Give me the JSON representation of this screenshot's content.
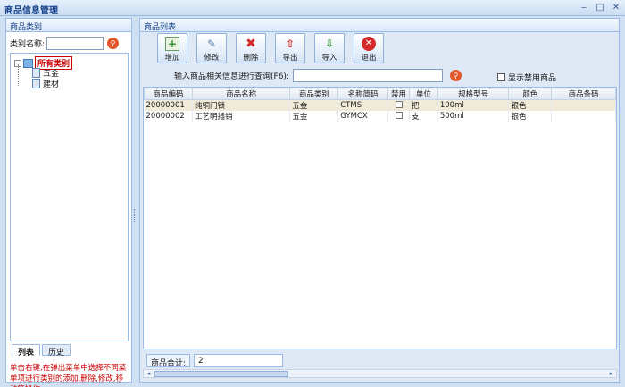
{
  "window": {
    "title": "商品信息管理",
    "minimize": "‒",
    "maximize": "□",
    "close": "✕"
  },
  "left": {
    "header": "商品类别",
    "search_label": "类别名称:",
    "search_value": "",
    "search_icon": "search-icon",
    "tree": {
      "root": "所有类别",
      "children": [
        "五金",
        "建材"
      ]
    },
    "tabs": [
      "列表",
      "历史"
    ],
    "hint": "单击右键,在弹出菜单中选择不同菜单项进行类别的添加,删除,修改,移动等操作"
  },
  "right": {
    "header": "商品列表",
    "toolbar": [
      {
        "label": "增加",
        "icon": "add-icon",
        "color": "#2f8f2f"
      },
      {
        "label": "修改",
        "icon": "edit-icon",
        "color": "#5a7fb0"
      },
      {
        "label": "删除",
        "icon": "delete-icon",
        "color": "#d42a2a"
      },
      {
        "label": "导出",
        "icon": "export-icon",
        "color": "#d42a2a"
      },
      {
        "label": "导入",
        "icon": "import-icon",
        "color": "#2f9a2f"
      },
      {
        "label": "退出",
        "icon": "exit-icon",
        "color": "#d42a2a"
      }
    ],
    "query_label": "输入商品相关信息进行查询(F6):",
    "query_value": "",
    "show_disabled_label": "显示禁用商品",
    "show_disabled_checked": false,
    "columns": [
      "商品编码",
      "商品名称",
      "商品类别",
      "名称简码",
      "禁用",
      "单位",
      "规格型号",
      "颜色",
      "商品条码"
    ],
    "rows": [
      [
        "20000001",
        "纯铜门锁",
        "五金",
        "CTMS",
        false,
        "把",
        "100ml",
        "银色",
        ""
      ],
      [
        "20000002",
        "工艺明插销",
        "五金",
        "GYMCX",
        false,
        "支",
        "500ml",
        "银色",
        ""
      ]
    ],
    "total_label": "商品合计:",
    "total_value": "2"
  },
  "colors": {
    "accent": "#15428b",
    "panel_border": "#99bbe8",
    "selected_row": "#f0ebd9",
    "hint": "#cc0000"
  }
}
